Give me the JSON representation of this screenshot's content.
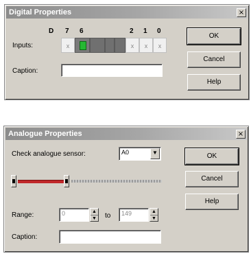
{
  "digital": {
    "title": "Digital Properties",
    "close_glyph": "×",
    "bit_headers": [
      "D",
      "7",
      "6",
      "2",
      "1",
      "0"
    ],
    "inputs_label": "Inputs:",
    "bits": [
      {
        "label": "x",
        "state": "off"
      },
      {
        "label": "",
        "state": "on"
      },
      {
        "label": "",
        "state": "dim"
      },
      {
        "label": "",
        "state": "dim"
      },
      {
        "label": "",
        "state": "dim"
      },
      {
        "label": "x",
        "state": "off"
      },
      {
        "label": "x",
        "state": "off"
      },
      {
        "label": "x",
        "state": "off"
      }
    ],
    "caption_label": "Caption:",
    "caption_value": "",
    "ok_label": "OK",
    "cancel_label": "Cancel",
    "help_label": "Help"
  },
  "analogue": {
    "title": "Analogue Properties",
    "close_glyph": "×",
    "sensor_label": "Check analogue sensor:",
    "sensor_value": "A0",
    "combo_arrow": "▼",
    "slider_level": 0.34,
    "range_label": "Range:",
    "range_min": "0",
    "range_to": "to",
    "range_max": "149",
    "spin_up": "▲",
    "spin_down": "▼",
    "caption_label": "Caption:",
    "caption_value": "",
    "ok_label": "OK",
    "cancel_label": "Cancel",
    "help_label": "Help"
  }
}
